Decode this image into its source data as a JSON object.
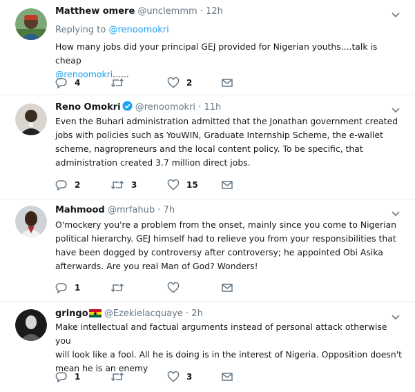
{
  "tweets": [
    {
      "name": "Matthew omere",
      "handle": "@unclemmm",
      "sep": "·",
      "time": "12h",
      "replying_prefix": "Replying to ",
      "replying_handle": "@renoomokri",
      "text_line1": "How many jobs did your principal GEJ provided for Nigerian youths....talk is cheap",
      "text_mention": "@renoomokri",
      "text_tail": "......",
      "reply_count": "4",
      "retweet_count": "",
      "like_count": "2"
    },
    {
      "name": "Reno Omokri",
      "handle": "@renoomokri",
      "sep": "·",
      "time": "11h",
      "lines": [
        "Even the Buhari administration admitted that the Jonathan government created",
        "jobs with policies such as YouWIN, Graduate Internship Scheme, the e-wallet",
        "scheme, nagropreneurs and the local content policy. To be specific, that",
        "administration created 3.7 million direct jobs."
      ],
      "reply_count": "2",
      "retweet_count": "3",
      "like_count": "15"
    },
    {
      "name": "Mahmood",
      "handle": "@mrfahub",
      "sep": "·",
      "time": "7h",
      "lines": [
        "O'mockery you're a problem from the onset, mainly since you come to Nigerian",
        "political hierarchy. GEJ himself had to relieve you from your responsibilities that",
        "have been dogged by controversy after controversy; he appointed Obi Asika",
        "afterwards. Are you real Man of God? Wonders!"
      ],
      "reply_count": "1",
      "retweet_count": "",
      "like_count": ""
    },
    {
      "name": "gringo",
      "handle": "@Ezekielacquaye",
      "sep": "·",
      "time": "2h",
      "lines": [
        "Make intellectual and factual arguments instead of personal attack otherwise you",
        "will look like a fool. All he is doing is in the interest of Nigeria. Opposition doesn't",
        "mean he is an enemy"
      ],
      "reply_count": "1",
      "retweet_count": "",
      "like_count": "3"
    }
  ],
  "colors": {
    "link": "#1da1f2",
    "secondary": "#657786",
    "icon": "#657786",
    "divider": "#e6ecf0"
  }
}
